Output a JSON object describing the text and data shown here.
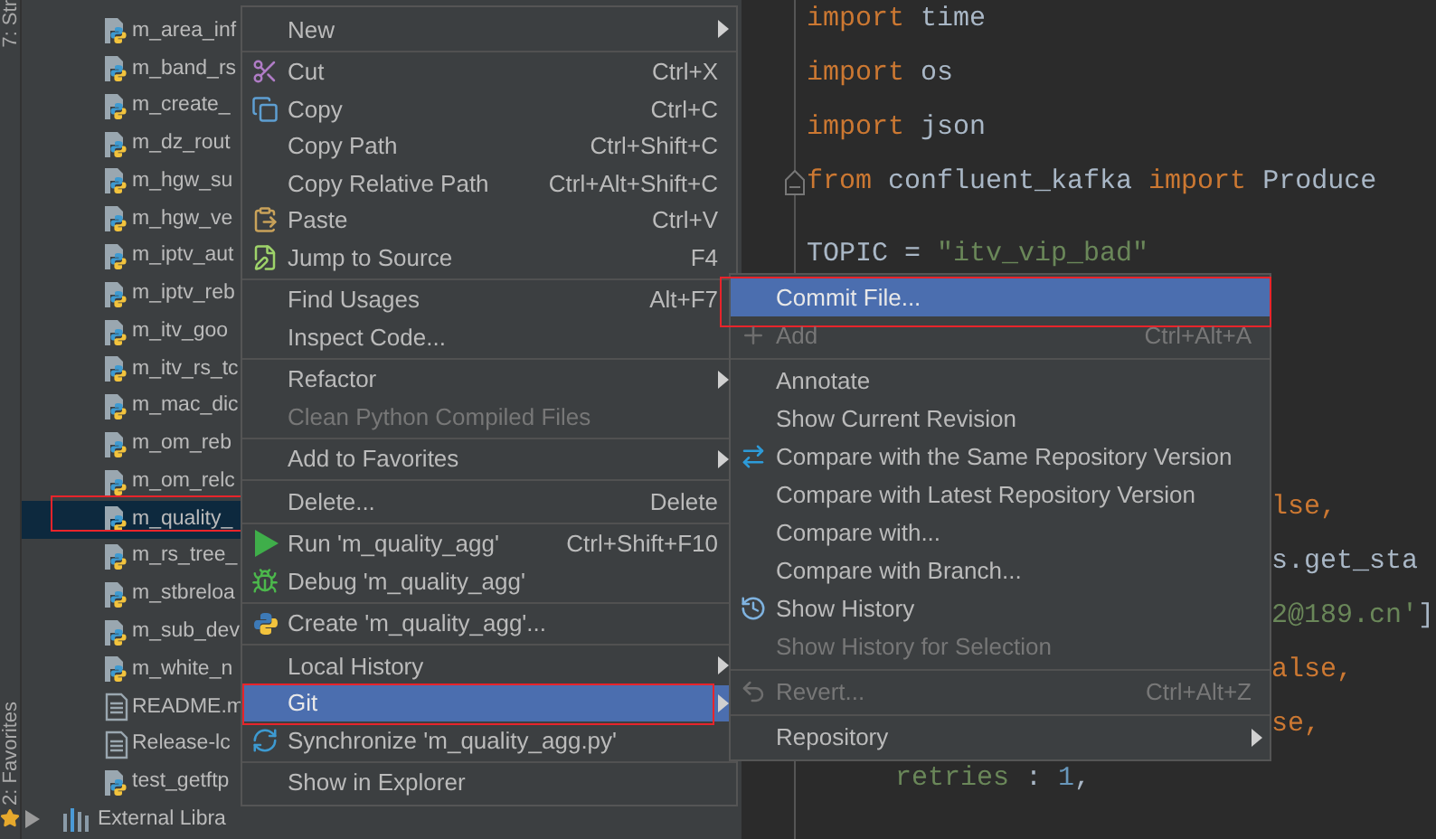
{
  "tool_strip": {
    "top_label": "7: Str",
    "bottom_label": "2: Favorites"
  },
  "project_tree": {
    "items": [
      {
        "kind": "python",
        "label": "m_area_inf",
        "selected": false,
        "highlighted": false
      },
      {
        "kind": "python",
        "label": "m_band_rs",
        "selected": false,
        "highlighted": false
      },
      {
        "kind": "python",
        "label": "m_create_",
        "selected": false,
        "highlighted": false
      },
      {
        "kind": "python",
        "label": "m_dz_rout",
        "selected": false,
        "highlighted": false
      },
      {
        "kind": "python",
        "label": "m_hgw_su",
        "selected": false,
        "highlighted": false
      },
      {
        "kind": "python",
        "label": "m_hgw_ve",
        "selected": false,
        "highlighted": false
      },
      {
        "kind": "python",
        "label": "m_iptv_aut",
        "selected": false,
        "highlighted": false
      },
      {
        "kind": "python",
        "label": "m_iptv_reb",
        "selected": false,
        "highlighted": false
      },
      {
        "kind": "python",
        "label": "m_itv_goo",
        "selected": false,
        "highlighted": false
      },
      {
        "kind": "python",
        "label": "m_itv_rs_tc",
        "selected": false,
        "highlighted": false
      },
      {
        "kind": "python",
        "label": "m_mac_dic",
        "selected": false,
        "highlighted": false
      },
      {
        "kind": "python",
        "label": "m_om_reb",
        "selected": false,
        "highlighted": false
      },
      {
        "kind": "python",
        "label": "m_om_relc",
        "selected": false,
        "highlighted": false
      },
      {
        "kind": "python",
        "label": "m_quality_",
        "selected": true,
        "highlighted": true
      },
      {
        "kind": "python",
        "label": "m_rs_tree_",
        "selected": false,
        "highlighted": false
      },
      {
        "kind": "python",
        "label": "m_stbreloa",
        "selected": false,
        "highlighted": false
      },
      {
        "kind": "python",
        "label": "m_sub_dev",
        "selected": false,
        "highlighted": false
      },
      {
        "kind": "python",
        "label": "m_white_n",
        "selected": false,
        "highlighted": false
      },
      {
        "kind": "text",
        "label": "README.m",
        "selected": false,
        "highlighted": false
      },
      {
        "kind": "text",
        "label": "Release-lc",
        "selected": false,
        "highlighted": false
      },
      {
        "kind": "python",
        "label": "test_getftp",
        "selected": false,
        "highlighted": false
      },
      {
        "kind": "library",
        "label": "External Libra",
        "selected": false,
        "highlighted": false
      }
    ]
  },
  "editor": {
    "lines": [
      {
        "kind": "code",
        "tokens": [
          {
            "text": "import",
            "kind": "keyword"
          },
          {
            "text": " time",
            "kind": "plain"
          }
        ]
      },
      {
        "kind": "code",
        "tokens": [
          {
            "text": "import",
            "kind": "keyword"
          },
          {
            "text": " os",
            "kind": "plain"
          }
        ]
      },
      {
        "kind": "code",
        "tokens": [
          {
            "text": "import",
            "kind": "keyword"
          },
          {
            "text": " json",
            "kind": "plain"
          }
        ]
      },
      {
        "kind": "code",
        "fold": true,
        "tokens": [
          {
            "text": "from",
            "kind": "keyword"
          },
          {
            "text": " confluent_kafka ",
            "kind": "plain"
          },
          {
            "text": "import",
            "kind": "keyword"
          },
          {
            "text": " Produce",
            "kind": "plain"
          }
        ]
      },
      {
        "kind": "short_blank"
      },
      {
        "kind": "code",
        "tokens": [
          {
            "text": "TOPIC = ",
            "kind": "plain"
          },
          {
            "text": "\"itv_vip_bad\"",
            "kind": "string"
          }
        ]
      },
      {
        "kind": "blank"
      },
      {
        "kind": "blank"
      },
      {
        "kind": "tall_blank"
      },
      {
        "kind": "tail",
        "tokens": [
          {
            "text": "lse,",
            "kind": "keyword"
          }
        ]
      },
      {
        "kind": "tail",
        "tokens": [
          {
            "text": "s.get_sta",
            "kind": "plain"
          }
        ]
      },
      {
        "kind": "tail",
        "tokens": [
          {
            "text": "2@189.cn'",
            "kind": "string"
          },
          {
            "text": "]",
            "kind": "plain"
          }
        ]
      },
      {
        "kind": "tail",
        "tokens": [
          {
            "text": "alse,",
            "kind": "keyword"
          }
        ]
      },
      {
        "kind": "tail",
        "tokens": [
          {
            "text": "se,",
            "kind": "keyword"
          }
        ]
      },
      {
        "kind": "indented",
        "tokens": [
          {
            "text": "retries",
            "kind": "string"
          },
          {
            "text": " : ",
            "kind": "plain"
          },
          {
            "text": "1",
            "kind": "number"
          },
          {
            "text": ",",
            "kind": "plain"
          }
        ]
      }
    ]
  },
  "context_menu": {
    "items": [
      {
        "kind": "item",
        "label": "New",
        "submenu": true,
        "disabled": false,
        "selected": false,
        "highlighted": false
      },
      {
        "kind": "separator"
      },
      {
        "kind": "item",
        "label": "Cut",
        "shortcut": "Ctrl+X",
        "submenu": false,
        "disabled": false,
        "selected": false,
        "highlighted": false
      },
      {
        "kind": "item",
        "label": "Copy",
        "shortcut": "Ctrl+C",
        "submenu": false,
        "disabled": false,
        "selected": false,
        "highlighted": false
      },
      {
        "kind": "item",
        "label": "Copy Path",
        "shortcut": "Ctrl+Shift+C",
        "submenu": false,
        "disabled": false,
        "selected": false,
        "highlighted": false
      },
      {
        "kind": "item",
        "label": "Copy Relative Path",
        "shortcut": "Ctrl+Alt+Shift+C",
        "submenu": false,
        "disabled": false,
        "selected": false,
        "highlighted": false
      },
      {
        "kind": "item",
        "label": "Paste",
        "shortcut": "Ctrl+V",
        "submenu": false,
        "disabled": false,
        "selected": false,
        "highlighted": false
      },
      {
        "kind": "item",
        "label": "Jump to Source",
        "shortcut": "F4",
        "submenu": false,
        "disabled": false,
        "selected": false,
        "highlighted": false
      },
      {
        "kind": "separator"
      },
      {
        "kind": "item",
        "label": "Find Usages",
        "shortcut": "Alt+F7",
        "submenu": false,
        "disabled": false,
        "selected": false,
        "highlighted": false
      },
      {
        "kind": "item",
        "label": "Inspect Code...",
        "submenu": false,
        "disabled": false,
        "selected": false,
        "highlighted": false
      },
      {
        "kind": "separator"
      },
      {
        "kind": "item",
        "label": "Refactor",
        "submenu": true,
        "disabled": false,
        "selected": false,
        "highlighted": false
      },
      {
        "kind": "item",
        "label": "Clean Python Compiled Files",
        "submenu": false,
        "disabled": true,
        "selected": false,
        "highlighted": false
      },
      {
        "kind": "separator"
      },
      {
        "kind": "item",
        "label": "Add to Favorites",
        "submenu": true,
        "disabled": false,
        "selected": false,
        "highlighted": false
      },
      {
        "kind": "separator"
      },
      {
        "kind": "item",
        "label": "Delete...",
        "shortcut": "Delete",
        "submenu": false,
        "disabled": false,
        "selected": false,
        "highlighted": false
      },
      {
        "kind": "separator"
      },
      {
        "kind": "item",
        "label": "Run 'm_quality_agg'",
        "shortcut": "Ctrl+Shift+F10",
        "submenu": false,
        "disabled": false,
        "selected": false,
        "highlighted": false
      },
      {
        "kind": "item",
        "label": "Debug 'm_quality_agg'",
        "submenu": false,
        "disabled": false,
        "selected": false,
        "highlighted": false
      },
      {
        "kind": "separator"
      },
      {
        "kind": "item",
        "label": "Create 'm_quality_agg'...",
        "submenu": false,
        "disabled": false,
        "selected": false,
        "highlighted": false
      },
      {
        "kind": "separator"
      },
      {
        "kind": "item",
        "label": "Local History",
        "submenu": true,
        "disabled": false,
        "selected": false,
        "highlighted": false
      },
      {
        "kind": "item",
        "label": "Git",
        "submenu": true,
        "disabled": false,
        "selected": true,
        "highlighted": true
      },
      {
        "kind": "item",
        "label": "Synchronize 'm_quality_agg.py'",
        "submenu": false,
        "disabled": false,
        "selected": false,
        "highlighted": false
      },
      {
        "kind": "separator"
      },
      {
        "kind": "item",
        "label": "Show in Explorer",
        "submenu": false,
        "disabled": false,
        "selected": false,
        "highlighted": false
      }
    ]
  },
  "git_submenu": {
    "items": [
      {
        "kind": "item",
        "label": "Commit File...",
        "submenu": false,
        "disabled": false,
        "selected": true,
        "highlighted": true
      },
      {
        "kind": "item",
        "label": "Add",
        "shortcut": "Ctrl+Alt+A",
        "submenu": false,
        "disabled": true,
        "selected": false,
        "highlighted": false
      },
      {
        "kind": "separator"
      },
      {
        "kind": "item",
        "label": "Annotate",
        "submenu": false,
        "disabled": false,
        "selected": false,
        "highlighted": false
      },
      {
        "kind": "item",
        "label": "Show Current Revision",
        "submenu": false,
        "disabled": false,
        "selected": false,
        "highlighted": false
      },
      {
        "kind": "item",
        "label": "Compare with the Same Repository Version",
        "submenu": false,
        "disabled": false,
        "selected": false,
        "highlighted": false
      },
      {
        "kind": "item",
        "label": "Compare with Latest Repository Version",
        "submenu": false,
        "disabled": false,
        "selected": false,
        "highlighted": false
      },
      {
        "kind": "item",
        "label": "Compare with...",
        "submenu": false,
        "disabled": false,
        "selected": false,
        "highlighted": false
      },
      {
        "kind": "item",
        "label": "Compare with Branch...",
        "submenu": false,
        "disabled": false,
        "selected": false,
        "highlighted": false
      },
      {
        "kind": "item",
        "label": "Show History",
        "submenu": false,
        "disabled": false,
        "selected": false,
        "highlighted": false
      },
      {
        "kind": "item",
        "label": "Show History for Selection",
        "submenu": false,
        "disabled": true,
        "selected": false,
        "highlighted": false
      },
      {
        "kind": "separator"
      },
      {
        "kind": "item",
        "label": "Revert...",
        "shortcut": "Ctrl+Alt+Z",
        "submenu": false,
        "disabled": true,
        "selected": false,
        "highlighted": false
      },
      {
        "kind": "separator"
      },
      {
        "kind": "item",
        "label": "Repository",
        "submenu": true,
        "disabled": false,
        "selected": false,
        "highlighted": false
      }
    ]
  }
}
